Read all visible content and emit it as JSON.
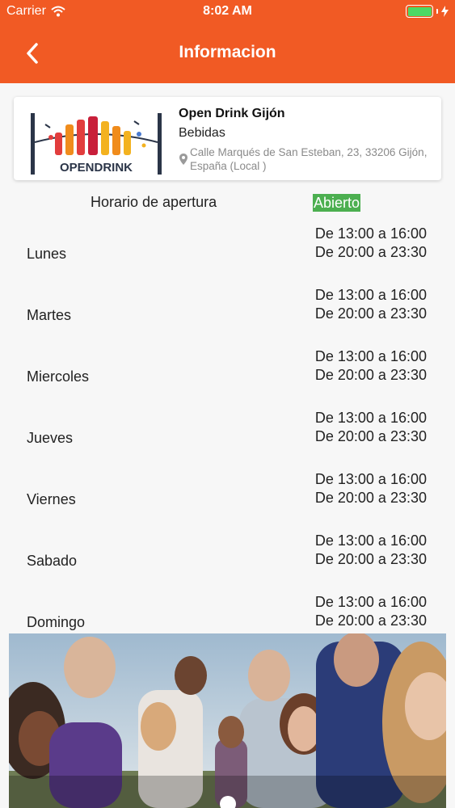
{
  "statusbar": {
    "carrier": "Carrier",
    "time": "8:02 AM"
  },
  "nav": {
    "title": "Informacion"
  },
  "store": {
    "logo_text": "OPENDRINK",
    "name": "Open Drink Gijón",
    "category": "Bebidas",
    "address": "Calle Marqués de San Esteban, 23, 33206 Gijón, España (Local )"
  },
  "hours": {
    "title": "Horario de apertura",
    "status": "Abierto",
    "days": [
      {
        "name": "Lunes",
        "slot1": "De 13:00 a 16:00",
        "slot2": "De 20:00 a 23:30"
      },
      {
        "name": "Martes",
        "slot1": "De 13:00 a 16:00",
        "slot2": "De 20:00 a 23:30"
      },
      {
        "name": "Miercoles",
        "slot1": "De 13:00 a 16:00",
        "slot2": "De 20:00 a 23:30"
      },
      {
        "name": "Jueves",
        "slot1": "De 13:00 a 16:00",
        "slot2": "De 20:00 a 23:30"
      },
      {
        "name": "Viernes",
        "slot1": "De 13:00 a 16:00",
        "slot2": "De 20:00 a 23:30"
      },
      {
        "name": "Sabado",
        "slot1": "De 13:00 a 16:00",
        "slot2": "De 20:00 a 23:30"
      },
      {
        "name": "Domingo",
        "slot1": "De 13:00 a 16:00",
        "slot2": "De 20:00 a 23:30"
      }
    ]
  },
  "colors": {
    "brand": "#f15a24",
    "open": "#4caf50"
  },
  "icons": {
    "back": "chevron-left-icon",
    "location": "location-pin-icon",
    "wifi": "wifi-icon",
    "battery": "battery-icon",
    "charging": "bolt-icon"
  }
}
